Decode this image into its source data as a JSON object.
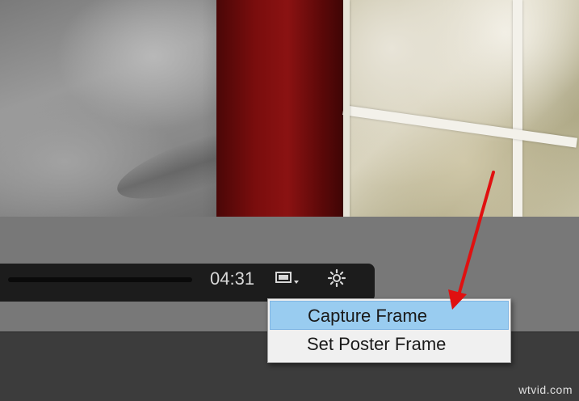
{
  "player": {
    "time": "04:31",
    "display_icon": "display-mode-icon",
    "settings_icon": "gear-icon"
  },
  "context_menu": {
    "items": [
      {
        "label": "Capture Frame",
        "highlighted": true
      },
      {
        "label": "Set Poster Frame",
        "highlighted": false
      }
    ]
  },
  "annotation": {
    "arrow_color": "#e01010"
  },
  "watermark": "wtvid.com",
  "colors": {
    "menu_highlight": "#99ccf0",
    "controls_bg": "#1c1c1c",
    "player_bg": "#787878"
  }
}
